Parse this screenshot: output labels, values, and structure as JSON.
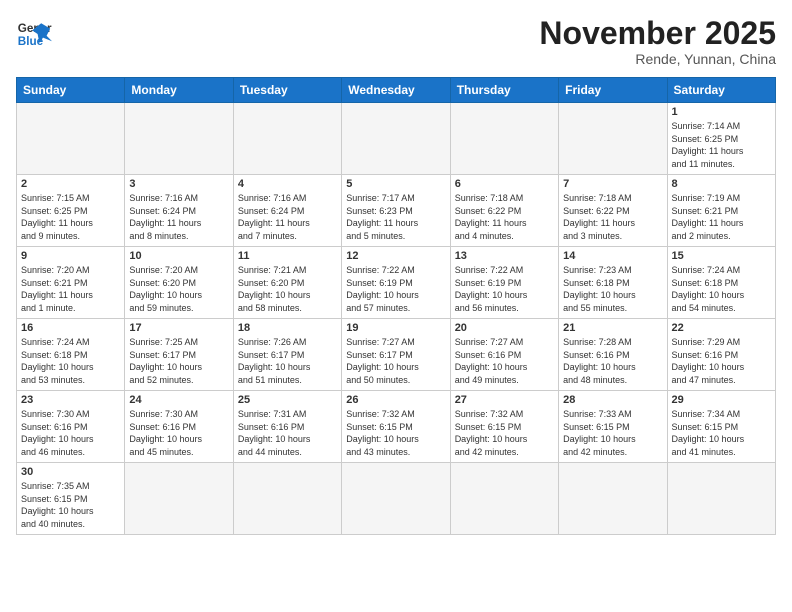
{
  "logo": {
    "text_general": "General",
    "text_blue": "Blue"
  },
  "title": "November 2025",
  "location": "Rende, Yunnan, China",
  "days_of_week": [
    "Sunday",
    "Monday",
    "Tuesday",
    "Wednesday",
    "Thursday",
    "Friday",
    "Saturday"
  ],
  "weeks": [
    [
      {
        "day": "",
        "info": ""
      },
      {
        "day": "",
        "info": ""
      },
      {
        "day": "",
        "info": ""
      },
      {
        "day": "",
        "info": ""
      },
      {
        "day": "",
        "info": ""
      },
      {
        "day": "",
        "info": ""
      },
      {
        "day": "1",
        "info": "Sunrise: 7:14 AM\nSunset: 6:25 PM\nDaylight: 11 hours\nand 11 minutes."
      }
    ],
    [
      {
        "day": "2",
        "info": "Sunrise: 7:15 AM\nSunset: 6:25 PM\nDaylight: 11 hours\nand 9 minutes."
      },
      {
        "day": "3",
        "info": "Sunrise: 7:16 AM\nSunset: 6:24 PM\nDaylight: 11 hours\nand 8 minutes."
      },
      {
        "day": "4",
        "info": "Sunrise: 7:16 AM\nSunset: 6:24 PM\nDaylight: 11 hours\nand 7 minutes."
      },
      {
        "day": "5",
        "info": "Sunrise: 7:17 AM\nSunset: 6:23 PM\nDaylight: 11 hours\nand 5 minutes."
      },
      {
        "day": "6",
        "info": "Sunrise: 7:18 AM\nSunset: 6:22 PM\nDaylight: 11 hours\nand 4 minutes."
      },
      {
        "day": "7",
        "info": "Sunrise: 7:18 AM\nSunset: 6:22 PM\nDaylight: 11 hours\nand 3 minutes."
      },
      {
        "day": "8",
        "info": "Sunrise: 7:19 AM\nSunset: 6:21 PM\nDaylight: 11 hours\nand 2 minutes."
      }
    ],
    [
      {
        "day": "9",
        "info": "Sunrise: 7:20 AM\nSunset: 6:21 PM\nDaylight: 11 hours\nand 1 minute."
      },
      {
        "day": "10",
        "info": "Sunrise: 7:20 AM\nSunset: 6:20 PM\nDaylight: 10 hours\nand 59 minutes."
      },
      {
        "day": "11",
        "info": "Sunrise: 7:21 AM\nSunset: 6:20 PM\nDaylight: 10 hours\nand 58 minutes."
      },
      {
        "day": "12",
        "info": "Sunrise: 7:22 AM\nSunset: 6:19 PM\nDaylight: 10 hours\nand 57 minutes."
      },
      {
        "day": "13",
        "info": "Sunrise: 7:22 AM\nSunset: 6:19 PM\nDaylight: 10 hours\nand 56 minutes."
      },
      {
        "day": "14",
        "info": "Sunrise: 7:23 AM\nSunset: 6:18 PM\nDaylight: 10 hours\nand 55 minutes."
      },
      {
        "day": "15",
        "info": "Sunrise: 7:24 AM\nSunset: 6:18 PM\nDaylight: 10 hours\nand 54 minutes."
      }
    ],
    [
      {
        "day": "16",
        "info": "Sunrise: 7:24 AM\nSunset: 6:18 PM\nDaylight: 10 hours\nand 53 minutes."
      },
      {
        "day": "17",
        "info": "Sunrise: 7:25 AM\nSunset: 6:17 PM\nDaylight: 10 hours\nand 52 minutes."
      },
      {
        "day": "18",
        "info": "Sunrise: 7:26 AM\nSunset: 6:17 PM\nDaylight: 10 hours\nand 51 minutes."
      },
      {
        "day": "19",
        "info": "Sunrise: 7:27 AM\nSunset: 6:17 PM\nDaylight: 10 hours\nand 50 minutes."
      },
      {
        "day": "20",
        "info": "Sunrise: 7:27 AM\nSunset: 6:16 PM\nDaylight: 10 hours\nand 49 minutes."
      },
      {
        "day": "21",
        "info": "Sunrise: 7:28 AM\nSunset: 6:16 PM\nDaylight: 10 hours\nand 48 minutes."
      },
      {
        "day": "22",
        "info": "Sunrise: 7:29 AM\nSunset: 6:16 PM\nDaylight: 10 hours\nand 47 minutes."
      }
    ],
    [
      {
        "day": "23",
        "info": "Sunrise: 7:30 AM\nSunset: 6:16 PM\nDaylight: 10 hours\nand 46 minutes."
      },
      {
        "day": "24",
        "info": "Sunrise: 7:30 AM\nSunset: 6:16 PM\nDaylight: 10 hours\nand 45 minutes."
      },
      {
        "day": "25",
        "info": "Sunrise: 7:31 AM\nSunset: 6:16 PM\nDaylight: 10 hours\nand 44 minutes."
      },
      {
        "day": "26",
        "info": "Sunrise: 7:32 AM\nSunset: 6:15 PM\nDaylight: 10 hours\nand 43 minutes."
      },
      {
        "day": "27",
        "info": "Sunrise: 7:32 AM\nSunset: 6:15 PM\nDaylight: 10 hours\nand 42 minutes."
      },
      {
        "day": "28",
        "info": "Sunrise: 7:33 AM\nSunset: 6:15 PM\nDaylight: 10 hours\nand 42 minutes."
      },
      {
        "day": "29",
        "info": "Sunrise: 7:34 AM\nSunset: 6:15 PM\nDaylight: 10 hours\nand 41 minutes."
      }
    ],
    [
      {
        "day": "30",
        "info": "Sunrise: 7:35 AM\nSunset: 6:15 PM\nDaylight: 10 hours\nand 40 minutes."
      },
      {
        "day": "",
        "info": ""
      },
      {
        "day": "",
        "info": ""
      },
      {
        "day": "",
        "info": ""
      },
      {
        "day": "",
        "info": ""
      },
      {
        "day": "",
        "info": ""
      },
      {
        "day": "",
        "info": ""
      }
    ]
  ]
}
